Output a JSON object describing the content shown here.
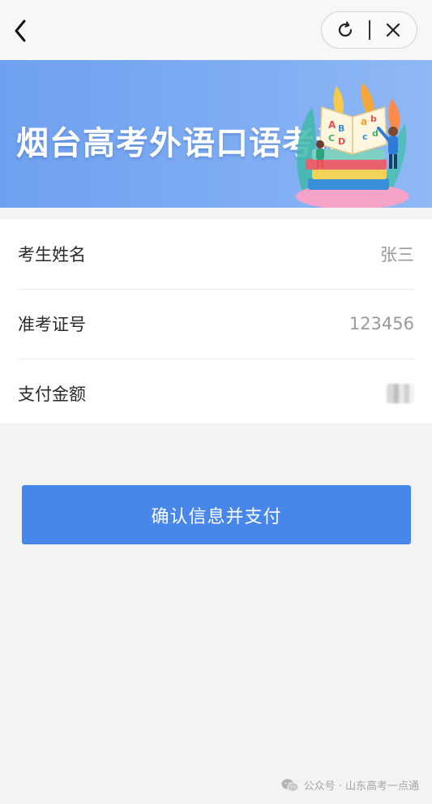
{
  "nav": {
    "back_icon": "chevron-left-icon",
    "refresh_icon": "refresh-icon",
    "close_icon": "close-icon"
  },
  "banner": {
    "title": "烟台高考外语口语考试",
    "colors": {
      "start": "#6fa0ef",
      "end": "#8fb8f5"
    },
    "book_letters": [
      "A",
      "B",
      "a",
      "b",
      "C",
      "D",
      "c",
      "d"
    ]
  },
  "form": {
    "rows": [
      {
        "label": "考生姓名",
        "value": "张三"
      },
      {
        "label": "准考证号",
        "value": "123456"
      },
      {
        "label": "支付金额",
        "value": ""
      }
    ]
  },
  "actions": {
    "pay_label": "确认信息并支付",
    "pay_color": "#4787ea"
  },
  "watermark": {
    "text": "公众号 · 山东高考一点通",
    "icon": "wechat-icon"
  }
}
